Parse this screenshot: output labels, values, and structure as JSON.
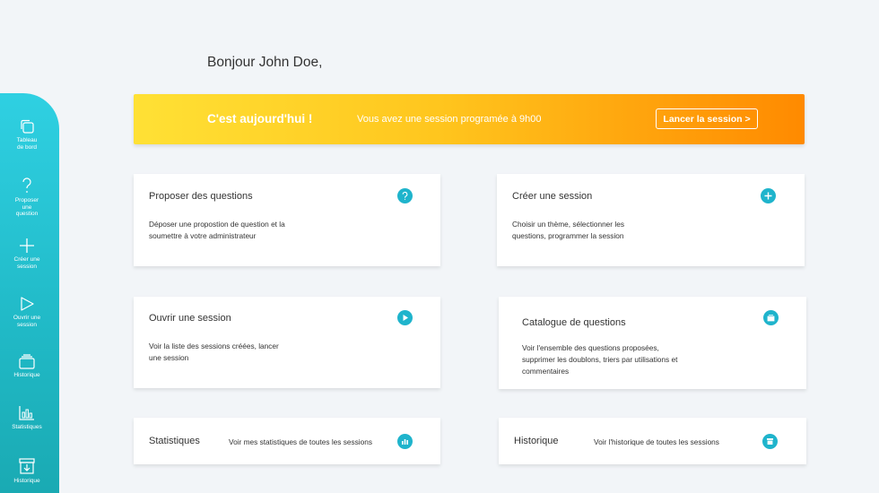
{
  "greeting": "Bonjour John Doe,",
  "sidebar": {
    "items": [
      {
        "label": "Tableau\nde bord",
        "icon": "dashboard-icon"
      },
      {
        "label": "Proposer\nune\nquestion",
        "icon": "question-icon"
      },
      {
        "label": "Créer une\nsession",
        "icon": "plus-icon"
      },
      {
        "label": "Ouvrir une\nsession",
        "icon": "play-icon"
      },
      {
        "label": "Historique",
        "icon": "history-icon"
      },
      {
        "label": "Statistiques",
        "icon": "bar-chart-icon"
      },
      {
        "label": "Historique",
        "icon": "archive-icon"
      }
    ]
  },
  "banner": {
    "title": "C'est aujourd'hui !",
    "text": "Vous avez une session programée à 9h00",
    "button": "Lancer la session >"
  },
  "cards": {
    "propose": {
      "title": "Proposer des questions",
      "desc": "Déposer une propostion de question et la\nsoumettre à votre administrateur",
      "icon": "question-circle-icon"
    },
    "create": {
      "title": "Créer une session",
      "desc": "Choisir un thème, sélectionner les\nquestions, programmer la session",
      "icon": "plus-circle-icon"
    },
    "open": {
      "title": "Ouvrir une session",
      "desc": "Voir la liste des sessions créées, lancer\nune session",
      "icon": "play-circle-icon"
    },
    "catalog": {
      "title": "Catalogue de questions",
      "desc": "Voir l'ensemble des questions proposées,\nsupprimer les doublons, triers par utilisations et\ncommentaires",
      "icon": "catalog-icon"
    },
    "stats": {
      "title": "Statistiques",
      "desc": "Voir mes statistiques de toutes les sessions",
      "icon": "bar-chart-circle-icon"
    },
    "history": {
      "title": "Historique",
      "desc": "Voir l'historique de toutes les sessions",
      "icon": "archive-circle-icon"
    }
  },
  "colors": {
    "accent": "#1fb4cc",
    "banner_start": "#ffe135",
    "banner_end": "#ff8a00"
  }
}
